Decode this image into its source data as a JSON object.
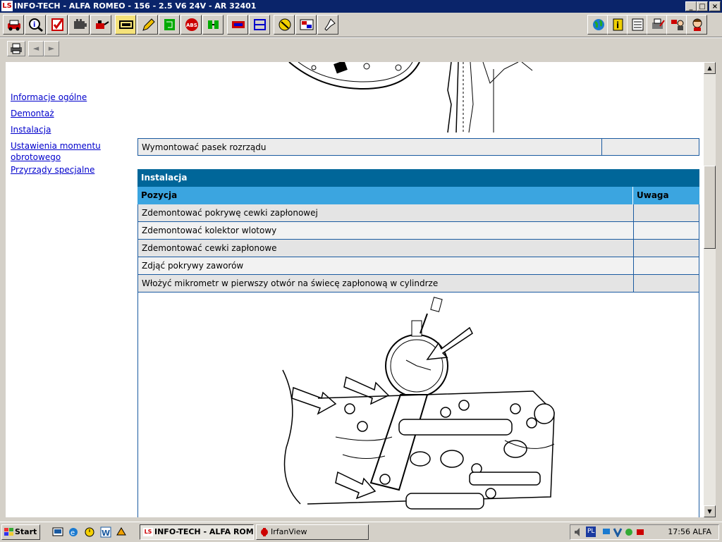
{
  "window": {
    "title": "INFO-TECH - ALFA ROMEO - 156 - 2.5 V6 24V - AR 32401",
    "app_icon_text": "LS",
    "controls": {
      "minimize": "_",
      "maximize": "□",
      "close": "×"
    }
  },
  "toolbar": {
    "left_icons": [
      "car-icon",
      "magnifier-info-icon",
      "checklist-icon",
      "engine-icon",
      "oil-can-icon",
      "timing-belt-icon",
      "pencil-icon",
      "circuit-board-icon",
      "abs-icon",
      "electrical-icon",
      "climate-icon",
      "diagram-icon",
      "tools-person-icon",
      "wiring-icon",
      "pin-icon"
    ],
    "right_icons": [
      "globe-icon",
      "info-icon",
      "notes-icon",
      "printer-edit-icon",
      "user-flag-icon",
      "help-person-icon"
    ],
    "abs_label": "ABS"
  },
  "toolbar2": {
    "back": "◄",
    "forward": "►"
  },
  "nav": {
    "links": [
      "Informacje ogólne",
      "Demontaż",
      "Instalacja",
      "Ustawienia momentu obrotowego",
      "Przyrządy specjalne"
    ]
  },
  "removal": {
    "rows": [
      {
        "position": "Wymontować pasek rozrządu",
        "note": ""
      }
    ]
  },
  "install": {
    "title": "Instalacja",
    "col_position": "Pozycja",
    "col_note": "Uwaga",
    "rows": [
      {
        "position": "Zdemontować pokrywę cewki zapłonowej",
        "note": ""
      },
      {
        "position": "Zdemontować kolektor wlotowy",
        "note": ""
      },
      {
        "position": "Zdemontować cewki zapłonowe",
        "note": ""
      },
      {
        "position": "Zdjąć pokrywy zaworów",
        "note": ""
      },
      {
        "position": "Włożyć mikrometr w pierwszy otwór na świecę zapłonową w cylindrze",
        "note": ""
      }
    ]
  },
  "scrollbar": {
    "up": "▲",
    "down": "▼"
  },
  "taskbar": {
    "start": "Start",
    "tasks": [
      {
        "label": "INFO-TECH - ALFA ROM...",
        "icon_text": "LS",
        "active": true
      },
      {
        "label": "IrfanView",
        "active": false
      }
    ],
    "tray": {
      "language": "PL",
      "clock": "17:56 ALFA"
    }
  },
  "colors": {
    "section_header": "#006699",
    "column_header": "#3ba5e0",
    "row_shade": "#e4e4e4",
    "link": "#0000cc"
  }
}
